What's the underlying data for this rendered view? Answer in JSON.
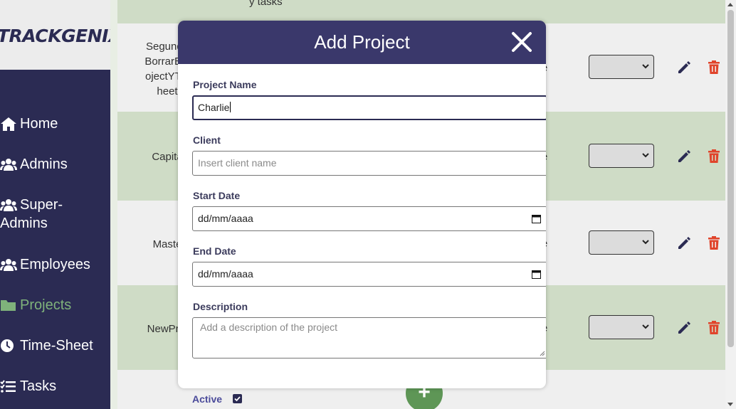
{
  "app": {
    "logo": "TRACKGENIX"
  },
  "sidebar": {
    "items": [
      {
        "label": "Home",
        "icon": "home-icon"
      },
      {
        "label": "Admins",
        "icon": "users-icon"
      },
      {
        "label": "Super-\nAdmins",
        "line1": "Super-",
        "line2": "Admins",
        "icon": "users-icon"
      },
      {
        "label": "Employees",
        "icon": "users-icon"
      },
      {
        "label": "Projects",
        "icon": "folder-icon",
        "active": true
      },
      {
        "label": "Time-Sheet",
        "icon": "clock-icon"
      },
      {
        "label": "Tasks",
        "icon": "tasks-icon"
      }
    ]
  },
  "table": {
    "top_cut_text": "y tasks",
    "rows": [
      {
        "name_lines": [
          "Segundo",
          "BorrarEst",
          "ojectYTin",
          "heet"
        ],
        "status": "ive"
      },
      {
        "name_lines": [
          "Capita"
        ],
        "status": "ive"
      },
      {
        "name_lines": [
          "Maste"
        ],
        "status": "ive"
      },
      {
        "name_lines": [
          "NewProj"
        ],
        "status": "ive"
      }
    ]
  },
  "modal": {
    "title": "Add Project",
    "fields": {
      "project_name": {
        "label": "Project Name",
        "value": "Charlie"
      },
      "client": {
        "label": "Client",
        "placeholder": "Insert client name"
      },
      "start_date": {
        "label": "Start Date",
        "placeholder": "dd/mm/aaaa"
      },
      "end_date": {
        "label": "End Date",
        "placeholder": "dd/mm/aaaa"
      },
      "description": {
        "label": "Description",
        "placeholder": "Add a description of the project"
      }
    },
    "active_label": "Active",
    "active_checked": true
  },
  "fab": {
    "label": "+"
  },
  "colors": {
    "sidebar_bg": "#2b2b53",
    "modal_header": "#3a386b",
    "active_nav": "#7fb27b",
    "row_green": "#cfdcc6",
    "delete_red": "#e0442b",
    "fab_green": "#5e9656"
  }
}
